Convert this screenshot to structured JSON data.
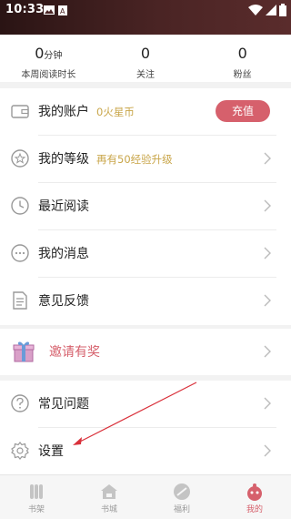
{
  "status": {
    "time": "10:33"
  },
  "stats": [
    {
      "value": "0",
      "unit": "分钟",
      "label": "本周阅读时长"
    },
    {
      "value": "0",
      "unit": "",
      "label": "关注"
    },
    {
      "value": "0",
      "unit": "",
      "label": "粉丝"
    }
  ],
  "account": {
    "label": "我的账户",
    "balance": "0火星币",
    "recharge": "充值"
  },
  "level": {
    "label": "我的等级",
    "hint": "再有50经验升级"
  },
  "recent": {
    "label": "最近阅读"
  },
  "messages": {
    "label": "我的消息"
  },
  "feedback": {
    "label": "意见反馈"
  },
  "invite": {
    "label": "邀请有奖"
  },
  "faq": {
    "label": "常见问题"
  },
  "settings": {
    "label": "设置"
  },
  "nav": [
    {
      "label": "书架",
      "icon": "bookshelf-icon"
    },
    {
      "label": "书城",
      "icon": "bookstore-icon"
    },
    {
      "label": "福利",
      "icon": "welfare-icon"
    },
    {
      "label": "我的",
      "icon": "profile-icon"
    }
  ],
  "colors": {
    "accent": "#d6606c",
    "gold": "#c9a64a",
    "header": "#3a1c1c"
  }
}
